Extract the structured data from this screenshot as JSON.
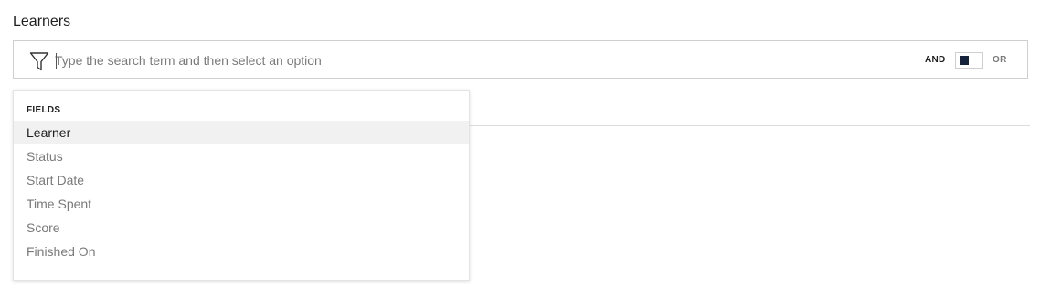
{
  "page": {
    "title": "Learners"
  },
  "filter_bar": {
    "icon": "filter-icon",
    "search_placeholder": "Type the search term and then select an option",
    "search_value": "",
    "and_label": "AND",
    "or_label": "OR",
    "toggle_selected": "AND",
    "colors": {
      "toggle_knob": "#14233b",
      "border": "#cfcfcf"
    }
  },
  "dropdown": {
    "header": "FIELDS",
    "highlighted_index": 0,
    "items": [
      {
        "label": "Learner"
      },
      {
        "label": "Status"
      },
      {
        "label": "Start Date"
      },
      {
        "label": "Time Spent"
      },
      {
        "label": "Score"
      },
      {
        "label": "Finished On"
      }
    ]
  }
}
